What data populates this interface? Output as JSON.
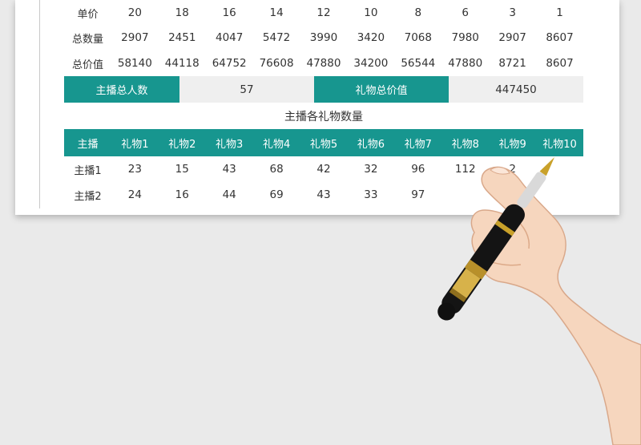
{
  "price_table": {
    "rows": [
      {
        "label": "单价",
        "values": [
          "20",
          "18",
          "16",
          "14",
          "12",
          "10",
          "8",
          "6",
          "3",
          "1"
        ]
      },
      {
        "label": "总数量",
        "values": [
          "2907",
          "2451",
          "4047",
          "5472",
          "3990",
          "3420",
          "7068",
          "7980",
          "2907",
          "8607"
        ]
      },
      {
        "label": "总价值",
        "values": [
          "58140",
          "44118",
          "64752",
          "76608",
          "47880",
          "34200",
          "56544",
          "47880",
          "8721",
          "8607"
        ]
      }
    ]
  },
  "summary": {
    "anchor_count_label": "主播总人数",
    "anchor_count_value": "57",
    "gift_total_label": "礼物总价值",
    "gift_total_value": "447450"
  },
  "gift_table": {
    "title": "主播各礼物数量",
    "headers": [
      "主播",
      "礼物1",
      "礼物2",
      "礼物3",
      "礼物4",
      "礼物5",
      "礼物6",
      "礼物7",
      "礼物8",
      "礼物9",
      "礼物10"
    ],
    "rows": [
      {
        "label": "主播1",
        "values": [
          "23",
          "15",
          "43",
          "68",
          "42",
          "32",
          "96",
          "112",
          "2",
          ""
        ]
      },
      {
        "label": "主播2",
        "values": [
          "24",
          "16",
          "44",
          "69",
          "43",
          "33",
          "97",
          "",
          "",
          ""
        ]
      }
    ]
  },
  "colors": {
    "accent": "#17968f",
    "summary_bg": "#efefef",
    "background": "#eaeaea"
  }
}
